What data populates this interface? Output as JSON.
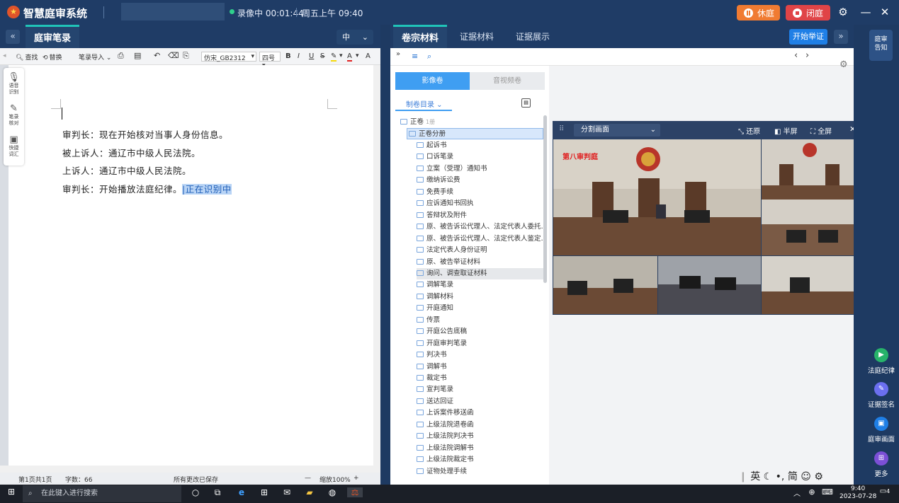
{
  "header": {
    "app_title": "智慧庭审系统",
    "recording": "录像中 00:01:44",
    "datetime": "周五上午 09:40",
    "btn_recess": "休庭",
    "btn_close": "闭庭"
  },
  "left": {
    "tab": "庭审笔录",
    "font_size_select": "中",
    "toolbar": {
      "find": "查找",
      "replace": "替换",
      "import": "笔录导入",
      "font": "仿宋_GB2312",
      "size": "四号"
    },
    "sidetools": [
      {
        "label1": "语音",
        "label2": "识别"
      },
      {
        "label1": "笔录",
        "label2": "核对"
      },
      {
        "label1": "快捷",
        "label2": "词汇"
      }
    ],
    "lines": [
      "审判长：现在开始核对当事人身份信息。",
      "被上诉人：通辽市中级人民法院。",
      "上诉人：通辽市中级人民法院。",
      "审判长：开始播放法庭纪律。"
    ],
    "recognizing": "|正在识别中",
    "status": {
      "pages": "第1页共1页",
      "chars": "字数：66",
      "saved": "所有更改已保存",
      "zoom": "缩放100%"
    }
  },
  "right": {
    "tabs": [
      "卷宗材料",
      "证据材料",
      "证据展示"
    ],
    "btn_evidence": "开始举证",
    "pills": [
      "影像卷",
      "音视频卷"
    ],
    "toc": "制卷目录",
    "tree_root": "正卷",
    "tree_root_badge": "1册",
    "tree_sub": "正卷分册",
    "tree_items": [
      "起诉书",
      "口诉笔录",
      "立案（受理）通知书",
      "缴纳诉讼费",
      "免费手续",
      "应诉通知书回执",
      "答辩状及附件",
      "原、被告诉讼代理人、法定代表人委托…",
      "原、被告诉讼代理人、法定代表人鉴定…",
      "法定代表人身份证明",
      "原、被告举证材料",
      "询问、调查取证材料",
      "调解笔录",
      "调解材料",
      "开庭通知",
      "传票",
      "开庭公告底稿",
      "开庭审判笔录",
      "判决书",
      "调解书",
      "裁定书",
      "宣判笔录",
      "送达回证",
      "上诉案件移送函",
      "上级法院退卷函",
      "上级法院判决书",
      "上级法院调解书",
      "上级法院裁定书",
      "证物处理手续"
    ],
    "video": {
      "split_label": "分割画面",
      "restore": "还原",
      "half": "半屏",
      "full": "全屏",
      "court_label": "第八审判庭"
    }
  },
  "sidebar": {
    "notice1": "庭审",
    "notice2": "告知",
    "items": [
      "法庭纪律",
      "证据签名",
      "庭审画面",
      "更多"
    ]
  },
  "taskbar": {
    "search": "在此键入进行搜索",
    "time": "9:40",
    "date": "2023-07-28",
    "ime": "英",
    "ime2": "简",
    "notif": "4"
  }
}
